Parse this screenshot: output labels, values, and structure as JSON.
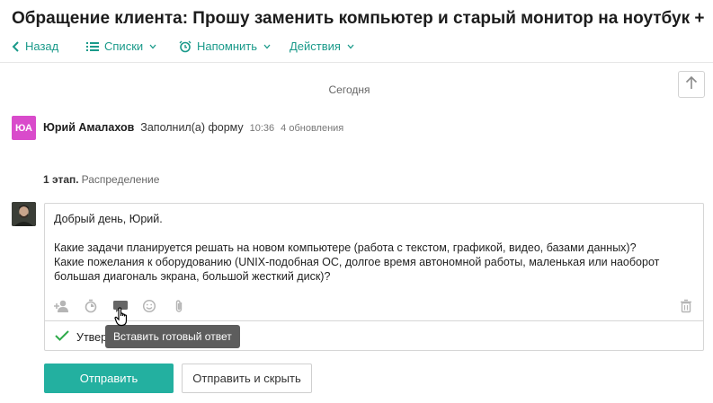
{
  "header": {
    "title": "Обращение клиента: Прошу заменить компьютер и старый монитор на ноутбук + монитор"
  },
  "toolbar": {
    "back_label": "Назад",
    "lists_label": "Списки",
    "remind_label": "Напомнить",
    "actions_label": "Действия"
  },
  "feed": {
    "date_separator": "Сегодня",
    "event": {
      "avatar_initials": "ЮА",
      "author": "Юрий Амалахов",
      "action": "Заполнил(а) форму",
      "time": "10:36",
      "updates": "4 обновления"
    },
    "stage": {
      "number": "1 этап.",
      "name": "Распределение"
    }
  },
  "editor": {
    "greeting": "Добрый день, Юрий.",
    "line1": "Какие задачи планируется решать на новом компьютере (работа с текстом, графикой, видео, базами данных)?",
    "line2": "Какие пожелания к оборудованию (UNIX-подобная ОС, долгое время автономной работы, маленькая или наоборот",
    "line3": "большая диагональ экрана, большой жесткий диск)?",
    "tooltip": "Вставить готовый ответ",
    "approve_label": "Утвер"
  },
  "actions": {
    "send_label": "Отправить",
    "send_hide_label": "Отправить и скрыть"
  },
  "colors": {
    "accent": "#23b0a0",
    "link": "#1a9a8a",
    "avatar_bg": "#d94bcb",
    "tooltip_bg": "#5d5d5d",
    "check": "#2eaa4a"
  }
}
